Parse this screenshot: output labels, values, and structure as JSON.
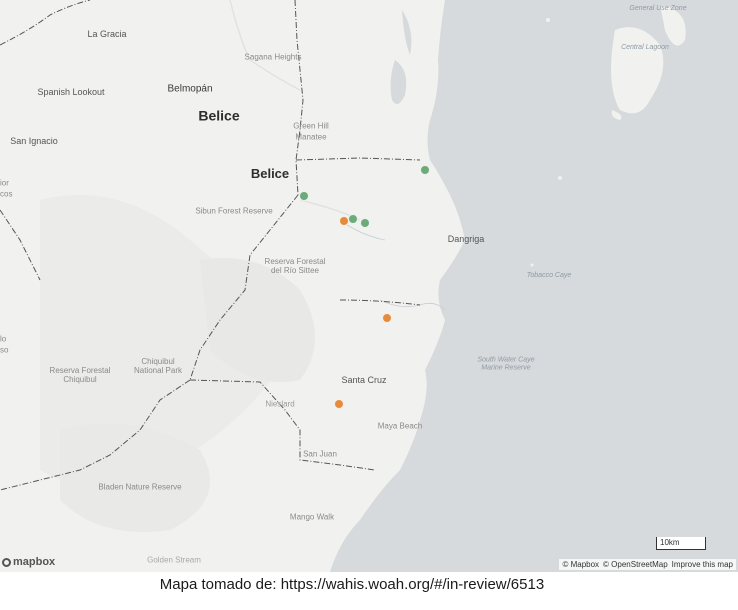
{
  "map": {
    "labels": {
      "la_gracia": "La Gracia",
      "sagana_heights": "Sagana Heights",
      "spanish_lookout": "Spanish Lookout",
      "belmopan": "Belmopán",
      "belice_country": "Belice",
      "san_ignacio": "San Ignacio",
      "green_hill": "Green Hill",
      "manatee": "Manatee",
      "belice_district": "Belice",
      "sibun": "Sibun Forest Reserve",
      "dangriga": "Dangriga",
      "sittee": "Reserva Forestal\ndel Río Sittee",
      "tobacco_caye": "Tobacco Caye",
      "chiquibul_np": "Chiquibul\nNational Park",
      "chiquibul_rf": "Reserva Forestal\nChiquibul",
      "south_water": "South Water Caye\nMarine Reserve",
      "santa_cruz": "Santa Cruz",
      "maya_beach": "Maya Beach",
      "san_juan": "San Juan",
      "bladen": "Bladen Nature Reserve",
      "mango_walk": "Mango Walk",
      "golden_stream": "Golden Stream",
      "general_use_zone": "General Use Zone",
      "central_lagoon": "Central Lagoon",
      "partial_edge_1": "ior",
      "partial_edge_2": "cos",
      "partial_edge_3": "lo",
      "partial_edge_4": "so",
      "nieslard": "Nieslard"
    },
    "markers": [
      {
        "name": "green-marker-1",
        "color": "#6daa7a"
      },
      {
        "name": "green-marker-2",
        "color": "#6daa7a"
      },
      {
        "name": "green-marker-3",
        "color": "#6daa7a"
      },
      {
        "name": "green-marker-4",
        "color": "#6daa7a"
      },
      {
        "name": "orange-marker-1",
        "color": "#e58c3c"
      },
      {
        "name": "orange-marker-2",
        "color": "#e58c3c"
      },
      {
        "name": "orange-marker-3",
        "color": "#e58c3c"
      }
    ],
    "logo": "mapbox",
    "attribution": {
      "mapbox": "© Mapbox",
      "osm": "© OpenStreetMap",
      "improve": "Improve this map"
    },
    "scale": "10km",
    "colors": {
      "land": "#f1f1f0",
      "water": "#d6dadc",
      "border": "#555555"
    }
  },
  "caption": "Mapa tomado de: https://wahis.woah.org/#/in-review/6513"
}
